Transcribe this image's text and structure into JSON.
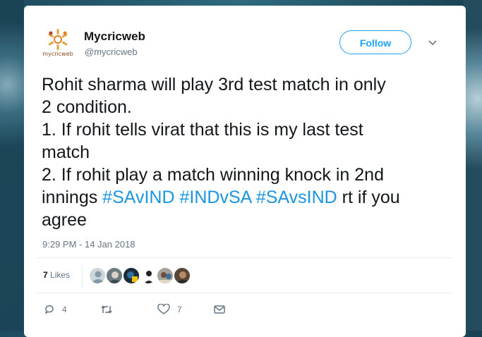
{
  "tweet": {
    "author_name": "Mycricweb",
    "author_handle": "@mycricweb",
    "logo_text": "mycricweb",
    "follow_label": "Follow",
    "text_line1": "Rohit sharma will play 3rd test match in only",
    "text_line2": "2 condition.",
    "text_line3": "1. If rohit tells virat that this is my last test",
    "text_line4": "match",
    "text_line5": "2. If rohit play a match winning knock in 2nd",
    "text_line6_prefix": "innings ",
    "hashtags": [
      "#SAvIND",
      "#INDvSA",
      "#SAvsIND"
    ],
    "text_line6_suffix": " rt if you",
    "text_line7": "agree",
    "timestamp": "9:29 PM - 14 Jan 2018",
    "likes_count": "7",
    "likes_label": "Likes",
    "reply_count": "4",
    "retweet_count": "",
    "like_count": "7"
  },
  "colors": {
    "accent": "#1da1f2",
    "hashtag": "#1b95e0",
    "muted": "#657786",
    "text": "#14171a"
  },
  "icons": [
    "mycricweb-logo",
    "chevron-down-icon",
    "reply-icon",
    "retweet-icon",
    "heart-icon",
    "message-icon"
  ]
}
